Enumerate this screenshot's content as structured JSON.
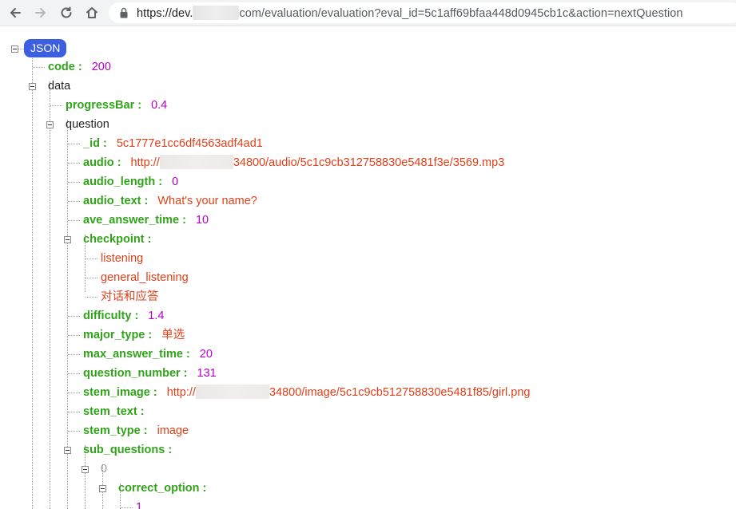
{
  "browser": {
    "url_prefix": "https://dev.",
    "url_suffix": "com/evaluation/evaluation?eval_id=5c1aff69bfaa448d0945cb1c&action=nextQuestion"
  },
  "json_viewer": {
    "root_label": "JSON",
    "code": {
      "key": "code :",
      "value": "200"
    },
    "data_label": "data",
    "progressBar": {
      "key": "progressBar :",
      "value": "0.4"
    },
    "question_label": "question",
    "id": {
      "key": "_id :",
      "value": "5c1777e1cc6df4563adf4ad1"
    },
    "audio": {
      "key": "audio :",
      "value_prefix": "http://",
      "value_suffix": "34800/audio/5c1c9cb312758830e5481f3e/3569.mp3"
    },
    "audio_length": {
      "key": "audio_length :",
      "value": "0"
    },
    "audio_text": {
      "key": "audio_text :",
      "value": "What's your name?"
    },
    "ave_answer_time": {
      "key": "ave_answer_time :",
      "value": "10"
    },
    "checkpoint": {
      "key": "checkpoint :",
      "items": [
        "listening",
        "general_listening",
        "对话和应答"
      ]
    },
    "difficulty": {
      "key": "difficulty :",
      "value": "1.4"
    },
    "major_type": {
      "key": "major_type :",
      "value": "单选"
    },
    "max_answer_time": {
      "key": "max_answer_time :",
      "value": "20"
    },
    "question_number": {
      "key": "question_number :",
      "value": "131"
    },
    "stem_image": {
      "key": "stem_image :",
      "value_prefix": "http://",
      "value_suffix": "34800/image/5c1c9cb512758830e5481f85/girl.png"
    },
    "stem_text": {
      "key": "stem_text :"
    },
    "stem_type": {
      "key": "stem_type :",
      "value": "image"
    },
    "sub_questions": {
      "key": "sub_questions :",
      "index": "0"
    },
    "correct_option": {
      "key": "correct_option :",
      "first_value": "1"
    }
  }
}
